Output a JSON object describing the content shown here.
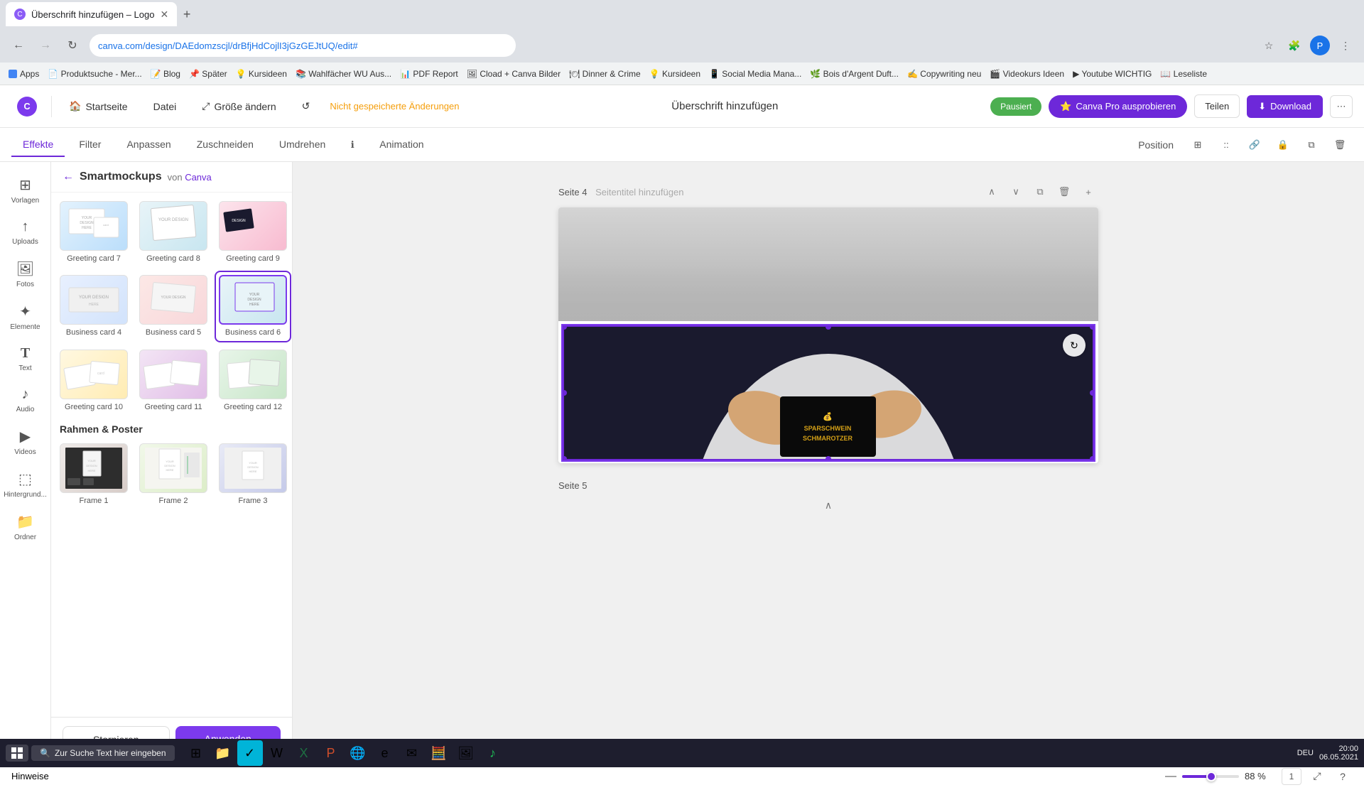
{
  "browser": {
    "tab_title": "Überschrift hinzufügen – Logo",
    "url": "canva.com/design/DAEdomzscjl/drBfjHdCojlI3jGzGEJtUQ/edit#",
    "bookmarks": [
      "Apps",
      "Produktsuche - Mer...",
      "Blog",
      "Später",
      "Kursideen",
      "Wahlfächer WU Aus...",
      "PDF Report",
      "Cload + Canva Bilder",
      "Dinner & Crime",
      "Kursideen",
      "Social Media Mana...",
      "Bois d'Argent Duft...",
      "Copywriting neu",
      "Videokurs Ideen",
      "Youtube WICHTIG",
      "Leseliste"
    ]
  },
  "toolbar": {
    "home_label": "Startseite",
    "file_label": "Datei",
    "resize_label": "Größe ändern",
    "unsaved_label": "Nicht gespeicherte Änderungen",
    "title": "Überschrift hinzufügen",
    "canva_pro_label": "Canva Pro ausprobieren",
    "share_label": "Teilen",
    "download_label": "Download",
    "pausiert_label": "Pausiert"
  },
  "secondary_toolbar": {
    "tabs": [
      "Effekte",
      "Filter",
      "Anpassen",
      "Zuschneiden",
      "Umdrehen",
      "Animation"
    ],
    "active_tab": "Effekte",
    "position_label": "Position"
  },
  "panel": {
    "back_label": "←",
    "title": "Smartmockups",
    "source_prefix": "von",
    "source_link": "Canva",
    "sections": {
      "cards": {
        "items": [
          {
            "id": "greeting7",
            "label": "Greeting card 7",
            "thumb_class": "thumb-greeting7"
          },
          {
            "id": "greeting8",
            "label": "Greeting card 8",
            "thumb_class": "thumb-greeting8"
          },
          {
            "id": "greeting9",
            "label": "Greeting card 9",
            "thumb_class": "thumb-greeting9"
          },
          {
            "id": "business4",
            "label": "Business card 4",
            "thumb_class": "thumb-business4"
          },
          {
            "id": "business5",
            "label": "Business card 5",
            "thumb_class": "thumb-business5"
          },
          {
            "id": "business6",
            "label": "Business card 6",
            "thumb_class": "thumb-business6",
            "selected": true
          },
          {
            "id": "greeting10",
            "label": "Greeting card 10",
            "thumb_class": "thumb-greeting10"
          },
          {
            "id": "greeting11",
            "label": "Greeting card 11",
            "thumb_class": "thumb-greeting11"
          },
          {
            "id": "greeting12",
            "label": "Greeting card 12",
            "thumb_class": "thumb-greeting12"
          }
        ]
      },
      "frames": {
        "heading": "Rahmen & Poster",
        "items": [
          {
            "id": "frame1",
            "label": "Frame 1",
            "thumb_class": "thumb-frame1"
          },
          {
            "id": "frame2",
            "label": "Frame 2",
            "thumb_class": "thumb-frame2"
          },
          {
            "id": "frame3",
            "label": "Frame 3",
            "thumb_class": "thumb-frame3"
          }
        ]
      }
    },
    "cancel_label": "Stornieren",
    "apply_label": "Anwenden"
  },
  "sidebar": {
    "items": [
      {
        "id": "vorlagen",
        "label": "Vorlagen",
        "icon": "⊞"
      },
      {
        "id": "uploads",
        "label": "Uploads",
        "icon": "↑"
      },
      {
        "id": "fotos",
        "label": "Fotos",
        "icon": "🖼"
      },
      {
        "id": "elemente",
        "label": "Elemente",
        "icon": "✦"
      },
      {
        "id": "text",
        "label": "Text",
        "icon": "T"
      },
      {
        "id": "audio",
        "label": "Audio",
        "icon": "♪"
      },
      {
        "id": "video",
        "label": "Videos",
        "icon": "▶"
      },
      {
        "id": "hintergrund",
        "label": "Hintergrund...",
        "icon": "⬚"
      },
      {
        "id": "ordner",
        "label": "Ordner",
        "icon": "📁"
      }
    ]
  },
  "canvas": {
    "page4_label": "Seite 4",
    "page4_subtitle": "Seitentitel hinzufügen",
    "page5_label": "Seite 5",
    "card_text_line1": "SPARSCHWEIN",
    "card_text_line2": "SCHMAROTZER",
    "refresh_icon": "↻"
  },
  "bottom_bar": {
    "notes_label": "Hinweise",
    "zoom_percent": "88 %",
    "page_indicator": "1"
  },
  "taskbar": {
    "search_placeholder": "Zur Suche Text hier eingeben",
    "time": "20:00",
    "date": "06.05.2021"
  }
}
